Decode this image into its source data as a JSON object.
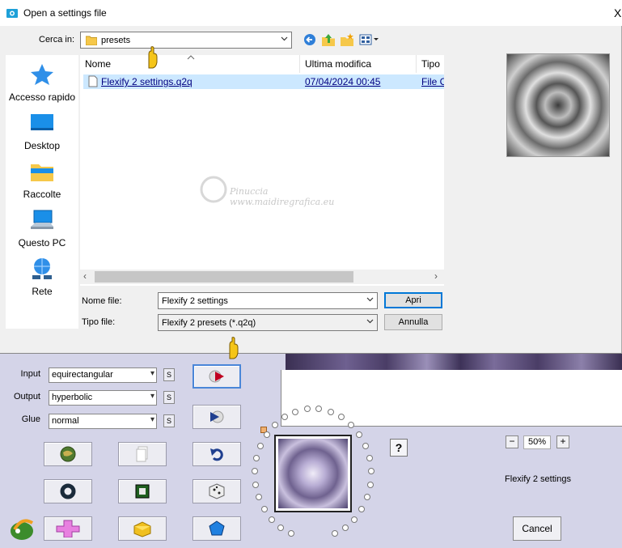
{
  "dialog": {
    "title": "Open a settings file",
    "close_glyph": "X",
    "look_in_label": "Cerca in:",
    "look_in_value": "presets",
    "places": [
      {
        "label": "Accesso rapido",
        "icon": "star-icon"
      },
      {
        "label": "Desktop",
        "icon": "desktop-icon"
      },
      {
        "label": "Raccolte",
        "icon": "libraries-folder-icon"
      },
      {
        "label": "Questo PC",
        "icon": "computer-icon"
      },
      {
        "label": "Rete",
        "icon": "network-icon"
      }
    ],
    "columns": [
      "Nome",
      "Ultima modifica",
      "Tipo"
    ],
    "files": [
      {
        "name": "Flexify 2 settings.q2q",
        "modified": "07/04/2024 00:45",
        "type": "File C"
      }
    ],
    "filename_label": "Nome file:",
    "filename_value": "Flexify 2 settings",
    "filetype_label": "Tipo file:",
    "filetype_value": "Flexify 2 presets (*.q2q)",
    "open_button": "Apri",
    "cancel_button": "Annulla",
    "watermark_line1": "Pinuccia",
    "watermark_line2": "www.maidiregrafica.eu"
  },
  "flexify": {
    "input_label": "Input",
    "input_value": "equirectangular",
    "output_label": "Output",
    "output_value": "hyperbolic",
    "glue_label": "Glue",
    "glue_value": "normal",
    "s_label": "S",
    "help_label": "?",
    "zoom_minus": "−",
    "zoom_value": "50%",
    "zoom_plus": "+",
    "preset_name": "Flexify 2 settings",
    "cancel_label": "Cancel"
  },
  "colors": {
    "accent": "#0078d7",
    "selection": "#cce8ff",
    "flexify_bg": "#d4d4e8"
  }
}
